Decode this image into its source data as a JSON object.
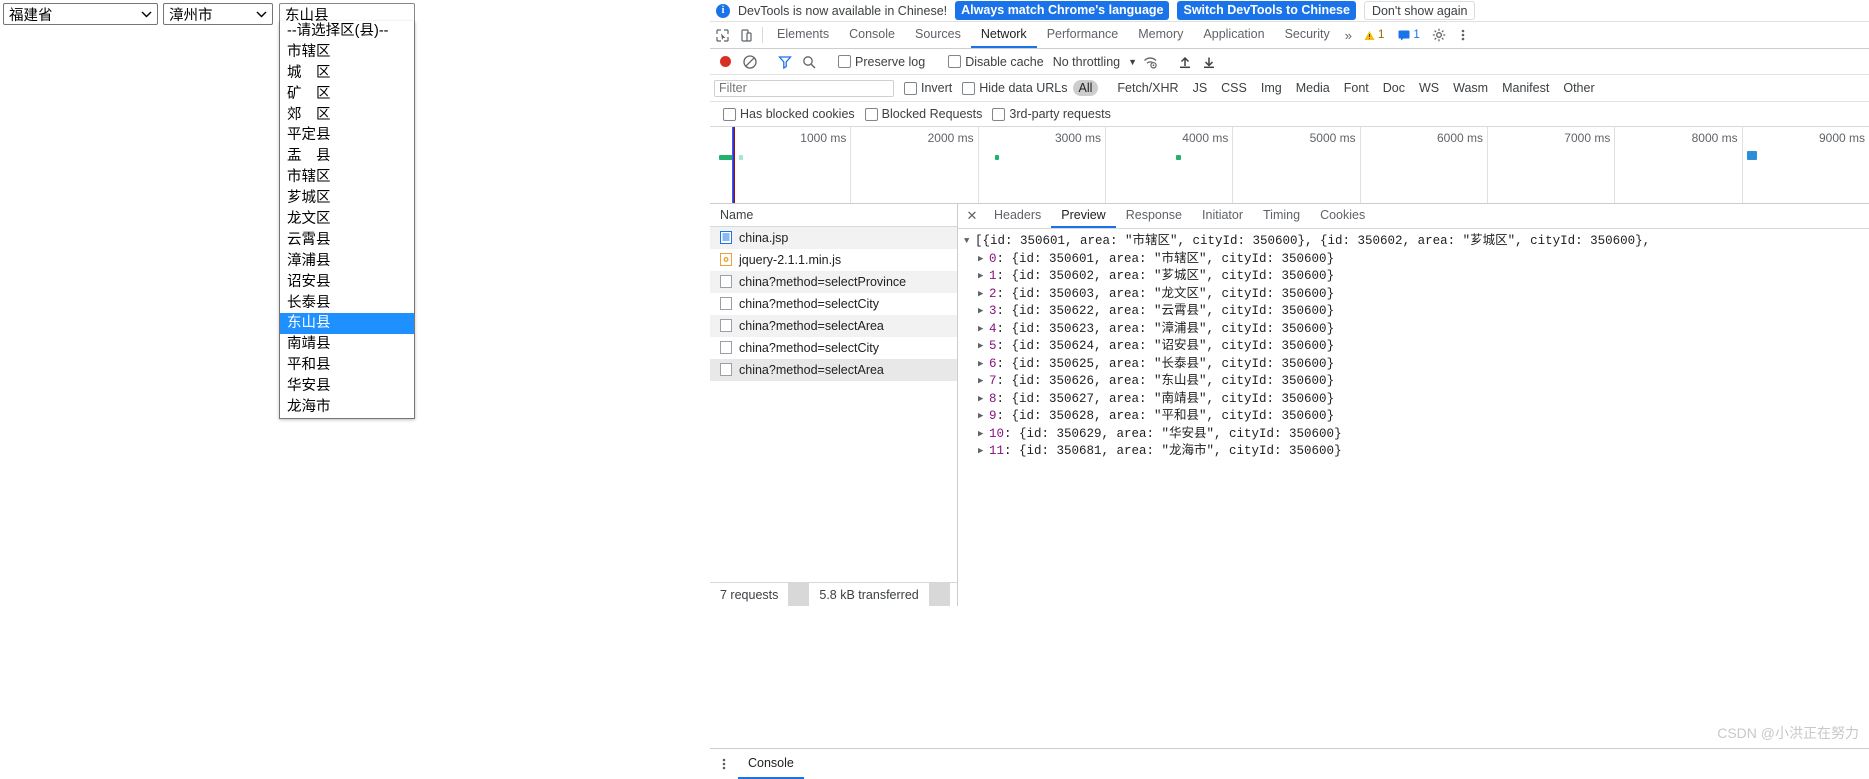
{
  "page": {
    "province_select": {
      "value": "福建省",
      "icon": "chevron-down-icon"
    },
    "city_select": {
      "value": "漳州市",
      "icon": "chevron-down-icon"
    },
    "area_select": {
      "value": "东山县"
    },
    "area_options": [
      "--请选择区(县)--",
      "市辖区",
      "城　区",
      "矿　区",
      "郊　区",
      "平定县",
      "盂　县",
      "市辖区",
      "芗城区",
      "龙文区",
      "云霄县",
      "漳浦县",
      "诏安县",
      "长泰县",
      "东山县",
      "南靖县",
      "平和县",
      "华安县",
      "龙海市"
    ],
    "area_selected_index": 14
  },
  "devtools": {
    "banner": {
      "icon": "info-icon",
      "message": "DevTools is now available in Chinese!",
      "always_match_label": "Always match Chrome's language",
      "switch_label": "Switch DevTools to Chinese",
      "dismiss_label": "Don't show again"
    },
    "toolbar_icons": {
      "inspect": "inspect-cursor-icon",
      "device": "device-toolbar-icon"
    },
    "tabs": [
      {
        "label": "Elements",
        "active": false
      },
      {
        "label": "Console",
        "active": false
      },
      {
        "label": "Sources",
        "active": false
      },
      {
        "label": "Network",
        "active": true
      },
      {
        "label": "Performance",
        "active": false
      },
      {
        "label": "Memory",
        "active": false
      },
      {
        "label": "Application",
        "active": false
      },
      {
        "label": "Security",
        "active": false
      }
    ],
    "more_tabs_icon": "chevron-double-right-icon",
    "warning_badge": {
      "icon": "warning-triangle-icon",
      "count": "1"
    },
    "message_badge": {
      "icon": "message-icon",
      "count": "1"
    },
    "settings_icon": "gear-icon",
    "kebab_icon": "more-vertical-icon",
    "network_toolbar": {
      "record_icon": "record-dot-icon",
      "clear_icon": "clear-prohibited-icon",
      "filter_icon": "funnel-icon",
      "search_icon": "search-icon",
      "preserve_log": "Preserve log",
      "disable_cache": "Disable cache",
      "throttling": "No throttling",
      "throttling_caret": "chevron-down-icon",
      "wifi_icon": "network-conditions-icon",
      "import_icon": "upload-arrow-icon",
      "export_icon": "download-arrow-icon"
    },
    "filter_bar": {
      "placeholder": "Filter",
      "value": "",
      "invert": "Invert",
      "hide_data_urls": "Hide data URLs",
      "types": [
        {
          "label": "All",
          "active": true
        },
        {
          "label": "Fetch/XHR",
          "active": false
        },
        {
          "label": "JS",
          "active": false
        },
        {
          "label": "CSS",
          "active": false
        },
        {
          "label": "Img",
          "active": false
        },
        {
          "label": "Media",
          "active": false
        },
        {
          "label": "Font",
          "active": false
        },
        {
          "label": "Doc",
          "active": false
        },
        {
          "label": "WS",
          "active": false
        },
        {
          "label": "Wasm",
          "active": false
        },
        {
          "label": "Manifest",
          "active": false
        },
        {
          "label": "Other",
          "active": false
        }
      ]
    },
    "cookie_bar": {
      "has_blocked_cookies": "Has blocked cookies",
      "blocked_requests": "Blocked Requests",
      "third_party": "3rd-party requests"
    },
    "overview": {
      "ticks": [
        "1000 ms",
        "2000 ms",
        "3000 ms",
        "4000 ms",
        "5000 ms",
        "6000 ms",
        "7000 ms",
        "8000 ms",
        "9000 ms"
      ]
    },
    "requests_panel": {
      "column_header": "Name",
      "rows": [
        {
          "name": "china.jsp",
          "icon": "document-icon",
          "selected": false
        },
        {
          "name": "jquery-2.1.1.min.js",
          "icon": "script-icon",
          "selected": false
        },
        {
          "name": "china?method=selectProvince",
          "icon": "generic-file-icon",
          "selected": false
        },
        {
          "name": "china?method=selectCity",
          "icon": "generic-file-icon",
          "selected": false
        },
        {
          "name": "china?method=selectArea",
          "icon": "generic-file-icon",
          "selected": false
        },
        {
          "name": "china?method=selectCity",
          "icon": "generic-file-icon",
          "selected": false
        },
        {
          "name": "china?method=selectArea",
          "icon": "generic-file-icon",
          "selected": true
        }
      ],
      "status_requests": "7 requests",
      "status_transferred": "5.8 kB transferred"
    },
    "detail_panel": {
      "close_icon": "close-icon",
      "tabs": [
        {
          "label": "Headers",
          "active": false
        },
        {
          "label": "Preview",
          "active": true
        },
        {
          "label": "Response",
          "active": false
        },
        {
          "label": "Initiator",
          "active": false
        },
        {
          "label": "Timing",
          "active": false
        },
        {
          "label": "Cookies",
          "active": false
        }
      ],
      "preview_root": "[{id: 350601, area: \"市辖区\", cityId: 350600}, {id: 350602, area: \"芗城区\", cityId: 350600},",
      "preview_rows": [
        {
          "index": "0",
          "text": ": {id: 350601, area: \"市辖区\", cityId: 350600}"
        },
        {
          "index": "1",
          "text": ": {id: 350602, area: \"芗城区\", cityId: 350600}"
        },
        {
          "index": "2",
          "text": ": {id: 350603, area: \"龙文区\", cityId: 350600}"
        },
        {
          "index": "3",
          "text": ": {id: 350622, area: \"云霄县\", cityId: 350600}"
        },
        {
          "index": "4",
          "text": ": {id: 350623, area: \"漳浦县\", cityId: 350600}"
        },
        {
          "index": "5",
          "text": ": {id: 350624, area: \"诏安县\", cityId: 350600}"
        },
        {
          "index": "6",
          "text": ": {id: 350625, area: \"长泰县\", cityId: 350600}"
        },
        {
          "index": "7",
          "text": ": {id: 350626, area: \"东山县\", cityId: 350600}"
        },
        {
          "index": "8",
          "text": ": {id: 350627, area: \"南靖县\", cityId: 350600}"
        },
        {
          "index": "9",
          "text": ": {id: 350628, area: \"平和县\", cityId: 350600}"
        },
        {
          "index": "10",
          "text": ": {id: 350629, area: \"华安县\", cityId: 350600}"
        },
        {
          "index": "11",
          "text": ": {id: 350681, area: \"龙海市\", cityId: 350600}"
        }
      ]
    },
    "drawer": {
      "kebab_icon": "more-vertical-icon",
      "tab_label": "Console"
    },
    "watermark": "CSDN @小洪正在努力"
  }
}
